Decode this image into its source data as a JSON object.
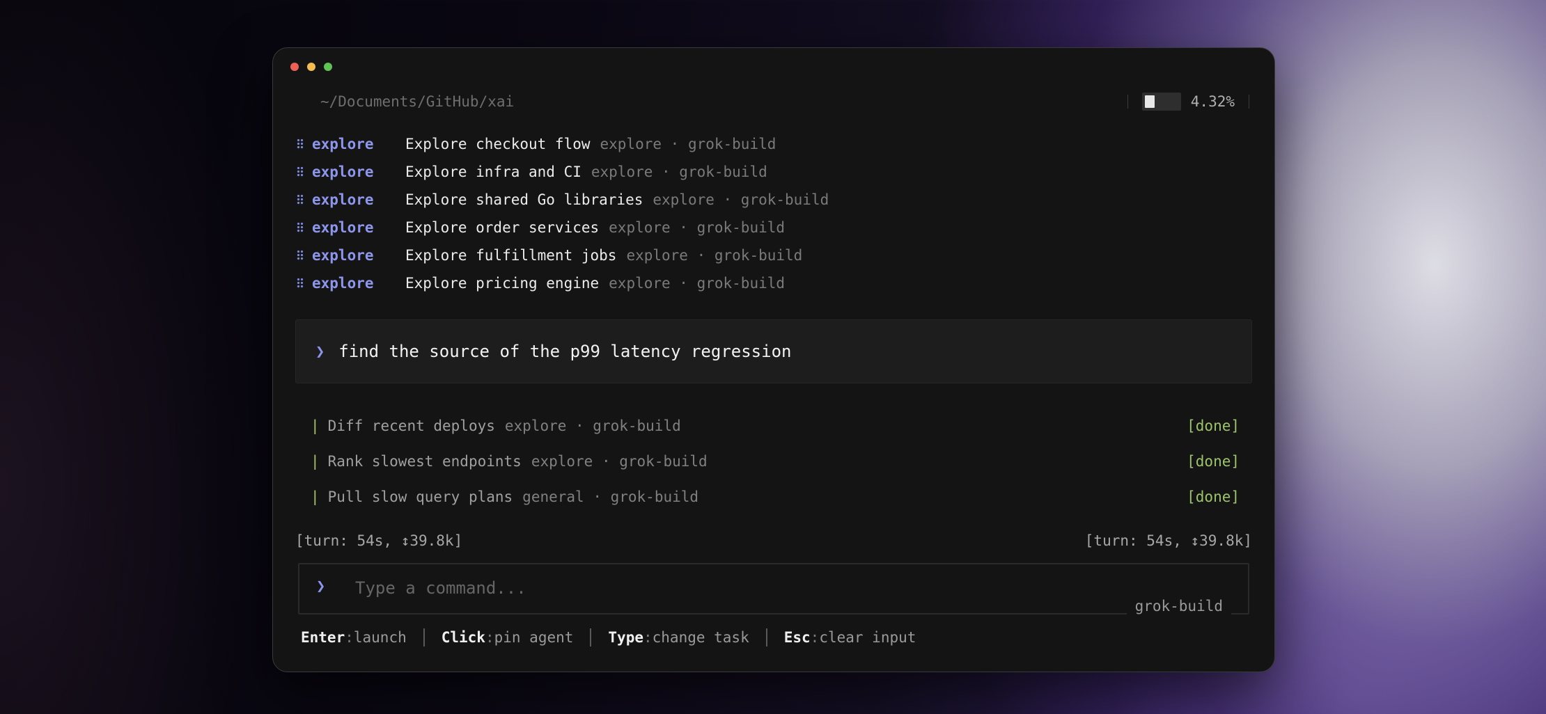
{
  "header": {
    "path": "~/Documents/GitHub/xai",
    "context_usage_percent": 4.32,
    "context_usage_label": "4.32%"
  },
  "agents": [
    {
      "kind": "explore",
      "title": "Explore checkout flow",
      "meta": "explore · grok-build"
    },
    {
      "kind": "explore",
      "title": "Explore infra and CI",
      "meta": "explore · grok-build"
    },
    {
      "kind": "explore",
      "title": "Explore shared Go libraries",
      "meta": "explore · grok-build"
    },
    {
      "kind": "explore",
      "title": "Explore order services",
      "meta": "explore · grok-build"
    },
    {
      "kind": "explore",
      "title": "Explore fulfillment jobs",
      "meta": "explore · grok-build"
    },
    {
      "kind": "explore",
      "title": "Explore pricing engine",
      "meta": "explore · grok-build"
    }
  ],
  "prompt": {
    "chevron": "❯",
    "text": "find the source of the p99 latency regression"
  },
  "tasks": [
    {
      "bar": "|",
      "title": "Diff recent deploys",
      "meta": "explore · grok-build",
      "status": "[done]"
    },
    {
      "bar": "|",
      "title": "Rank slowest endpoints",
      "meta": "explore · grok-build",
      "status": "[done]"
    },
    {
      "bar": "|",
      "title": "Pull slow query plans",
      "meta": "general · grok-build",
      "status": "[done]"
    }
  ],
  "turn": {
    "left": "[turn: 54s, ↕39.8k]",
    "right": "[turn: 54s, ↕39.8k]"
  },
  "input": {
    "chevron": "❯",
    "value": "",
    "placeholder": "Type a command...",
    "model": "grok-build"
  },
  "hints": [
    {
      "key": "Enter",
      "desc": "launch"
    },
    {
      "key": "Click",
      "desc": "pin agent"
    },
    {
      "key": "Type",
      "desc": "change task"
    },
    {
      "key": "Esc",
      "desc": "clear input"
    }
  ],
  "colors": {
    "accent": "#8c96ea",
    "done": "#9cc46b",
    "window_bg": "#141414"
  }
}
